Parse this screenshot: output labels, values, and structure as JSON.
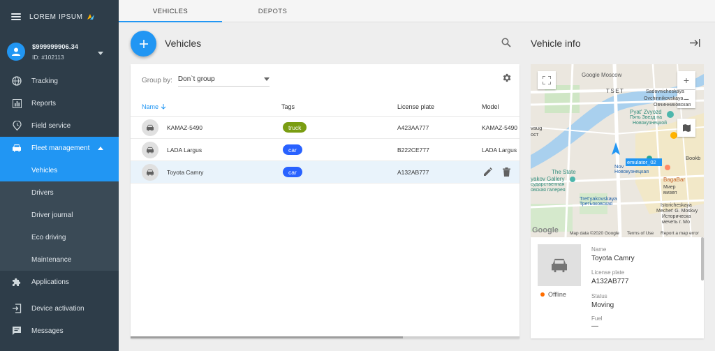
{
  "brand": {
    "name": "LOREM IPSUM"
  },
  "user": {
    "balance": "$999999906.34",
    "id": "ID: #102113"
  },
  "nav": {
    "tracking": "Tracking",
    "reports": "Reports",
    "field_service": "Field service",
    "fleet_management": "Fleet management",
    "sub": {
      "vehicles": "Vehicles",
      "drivers": "Drivers",
      "driver_journal": "Driver journal",
      "eco_driving": "Eco driving",
      "maintenance": "Maintenance"
    },
    "applications": "Applications",
    "device_activation": "Device activation",
    "messages": "Messages"
  },
  "tabs": {
    "vehicles": "VEHICLES",
    "depots": "DEPOTS"
  },
  "vehicles_panel": {
    "title": "Vehicles",
    "group_by_label": "Group by:",
    "group_by_value": "Don`t group",
    "columns": {
      "name": "Name",
      "tags": "Tags",
      "plate": "License plate",
      "model": "Model"
    },
    "rows": [
      {
        "name": "KAMAZ-5490",
        "tag": "truck",
        "tag_color": "#7a9d12",
        "plate": "A423AA777",
        "model": "KAMAZ-5490"
      },
      {
        "name": "LADA Largus",
        "tag": "car",
        "tag_color": "#2962ff",
        "plate": "B222CE777",
        "model": "LADA Largus"
      },
      {
        "name": "Toyota Camry",
        "tag": "car",
        "tag_color": "#2962ff",
        "plate": "A132AB777",
        "model": ""
      }
    ]
  },
  "vehicle_info": {
    "title": "Vehicle info",
    "map": {
      "labels": {
        "google_moscow": "Google Moscow",
        "tset": "TSET",
        "sadovnicheskaya": "Sadovnicheskaya",
        "ovchinnikovskaya": "Ovchinnikovskaya",
        "ovchinnikovskaya_ru": "Овчинниковская",
        "pyat_zvyozd": "Pyat' Zvyozd",
        "pyat_zvezd_ru": "Пять Звезд на",
        "novokuznetskoy_ru": "Новокузнецкой",
        "vaug": "vaug",
        "ost": "ост",
        "novo_prefix": "Nov",
        "novokuznetskaya_ru": "Новокузнецкая",
        "emulator": "emulator_02",
        "bookb": "Bookb",
        "gallery_1": "The State",
        "gallery_2": "yakov Gallery",
        "gallery_3": "сударственная",
        "gallery_4": "овская галерея",
        "bagabar": "BagaBar",
        "mir_1": "Миер",
        "mir_2": "мизеп",
        "tretyakovskaya": "Tret'yakovskaya",
        "tretyakovskaya_ru": "Третьяковская",
        "ist_1": "Istoricheskaya",
        "ist_2": "Mechet' G. Moskvy",
        "ist_3": "Историческа",
        "ist_4": "мечеть г. Мо"
      },
      "google_logo": "Google",
      "data_credit": "Map data ©2020 Google",
      "terms": "Terms of Use",
      "report": "Report a map error"
    },
    "status": "Offline",
    "status_color": "#ff6d00",
    "fields": {
      "name_label": "Name",
      "name_value": "Toyota Camry",
      "plate_label": "License plate",
      "plate_value": "A132AB777",
      "status_label": "Status",
      "status_value": "Moving",
      "fuel_label": "Fuel",
      "fuel_value": "—"
    }
  },
  "colors": {
    "accent": "#2196f3",
    "sidebar": "#2e3d49"
  }
}
